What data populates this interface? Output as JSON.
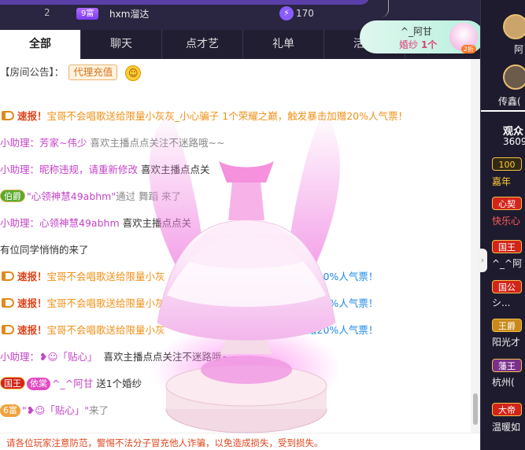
{
  "topbar": {
    "rank": "2",
    "level": "9富",
    "user": "hxm溜达",
    "score": "170",
    "score_icon": "lightning-icon"
  },
  "gift_popup": {
    "user": "^_阿甘",
    "gift": "婚纱",
    "count": "1个",
    "badge": "2折"
  },
  "side": {
    "avatar_name_1": "阿",
    "avatar_name_2": "传鑫(",
    "audience_label": "观众",
    "audience_count": "3609",
    "rows": [
      {
        "badge": "100",
        "name": "嘉年"
      },
      {
        "badge": "心契",
        "name": "快乐心"
      },
      {
        "badge": "国王",
        "name": "^_^阿"
      },
      {
        "badge": "国公",
        "name": "シ..."
      },
      {
        "badge": "王爵",
        "name": "阳光才"
      },
      {
        "badge": "藩王",
        "name": "杭州("
      },
      {
        "badge": "大帝",
        "name": "温暖如"
      }
    ]
  },
  "tabs": [
    "全部",
    "聊天",
    "点才艺",
    "礼单",
    "活动"
  ],
  "notice": {
    "label": "【房间公告】：",
    "button": "代理充值"
  },
  "broadcast": {
    "prefix": "速报！",
    "text1": "宝哥不会唱歌送给限量小灰灰_小心骗子 1个荣耀之巅，触发暴击加赠20%人气票！",
    "a": "宝哥不会唱歌送给限量小灰",
    "b": "加赠20%人气票！"
  },
  "messages": {
    "helper_label": "小助理：",
    "m2_name": "芳家~伟少",
    "m2_text": "喜欢主播点点关注不迷路哦~~",
    "m3_name": "昵称违规，请重新修改",
    "m3_text": "喜欢主播点点关",
    "m4_badge": "伯爵",
    "m4_name": "\"心领神慧49abhm\"",
    "m4_text": "通过 舞蹈 来了",
    "m5_name": "心领神慧49abhm",
    "m5_text": "喜欢主播点点关",
    "m6_text": "有位同学悄悄的来了",
    "m7_name": "❥☺「贴心」",
    "m7_text": "喜欢主播点点关注不迷路哦~~",
    "m8_b1": "国王",
    "m8_b2": "依棠",
    "m8_name": "^_^阿甘",
    "m8_text": "送1个婚纱",
    "m9_badge": "6富",
    "m9_name": "\"❥☺「贴心」\"",
    "m9_text": "来了"
  },
  "footer": "请各位玩家注意防范，警惕不法分子冒充他人诈骗，以免造成损失，受到损失。",
  "colors": {
    "accent": "#e0441c",
    "helper": "#c444c9",
    "link": "#1e88e5",
    "dark": "#221e32"
  }
}
